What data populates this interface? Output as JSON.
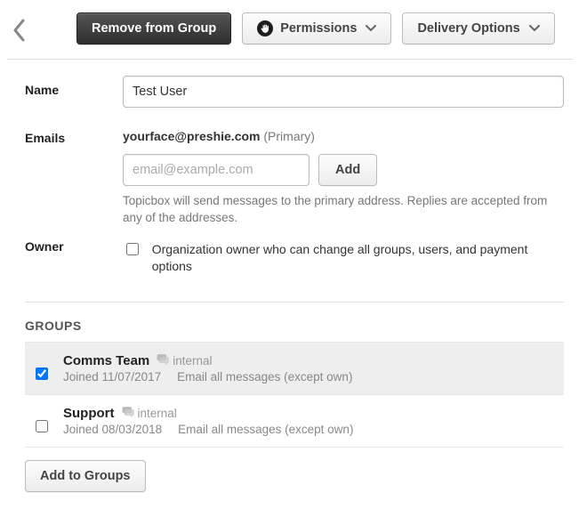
{
  "toolbar": {
    "remove_label": "Remove from Group",
    "permissions_label": "Permissions",
    "delivery_label": "Delivery Options"
  },
  "fields": {
    "name_label": "Name",
    "name_value": "Test User",
    "emails_label": "Emails",
    "primary_email": "yourface@preshie.com",
    "primary_tag": "(Primary)",
    "email_placeholder": "email@example.com",
    "add_label": "Add",
    "email_help": "Topicbox will send messages to the primary address. Replies are accepted from any of the addresses.",
    "owner_label": "Owner",
    "owner_checkbox_label": "Organization owner who can change all groups, users, and payment options"
  },
  "groups": {
    "heading": "GROUPS",
    "items": [
      {
        "name": "Comms Team",
        "visibility": "internal",
        "joined": "Joined 11/07/2017",
        "delivery": "Email all messages (except own)",
        "checked": true
      },
      {
        "name": "Support",
        "visibility": "internal",
        "joined": "Joined 08/03/2018",
        "delivery": "Email all messages (except own)",
        "checked": false
      }
    ],
    "add_to_groups_label": "Add to Groups"
  }
}
